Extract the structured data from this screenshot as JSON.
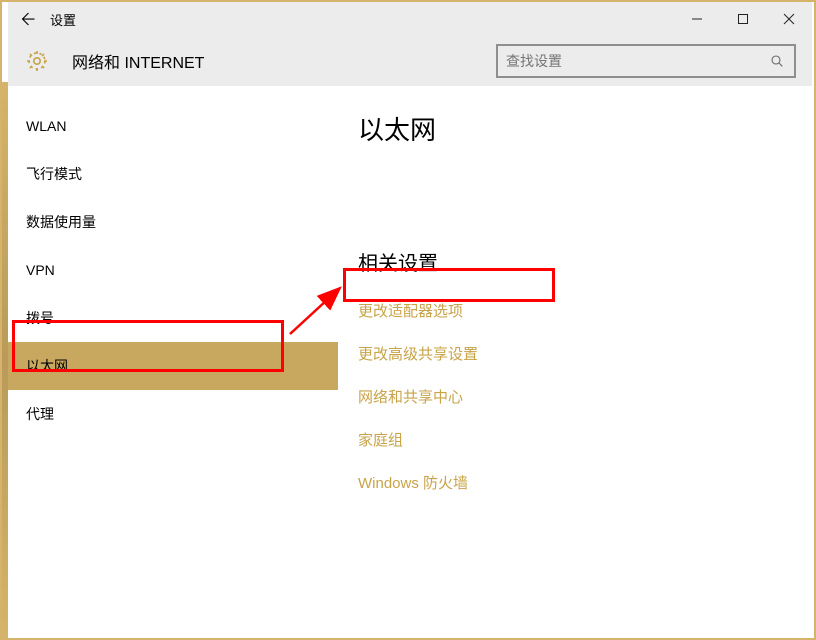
{
  "window_title": "设置",
  "category_title": "网络和 INTERNET",
  "search": {
    "placeholder": "查找设置"
  },
  "sidebar": {
    "items": [
      {
        "label": "WLAN"
      },
      {
        "label": "飞行模式"
      },
      {
        "label": "数据使用量"
      },
      {
        "label": "VPN"
      },
      {
        "label": "拨号"
      },
      {
        "label": "以太网",
        "selected": true
      },
      {
        "label": "代理"
      }
    ]
  },
  "main": {
    "heading": "以太网",
    "related_heading": "相关设置",
    "links": [
      "更改适配器选项",
      "更改高级共享设置",
      "网络和共享中心",
      "家庭组",
      "Windows 防火墙"
    ]
  }
}
